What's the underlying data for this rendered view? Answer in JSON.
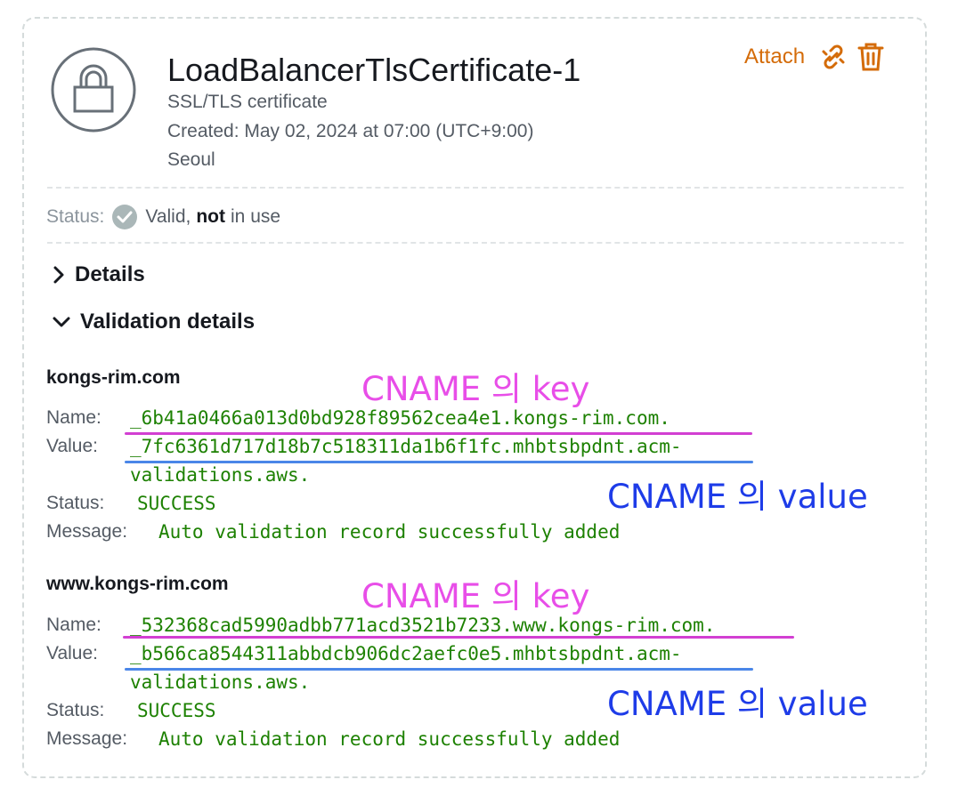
{
  "certificate": {
    "name": "LoadBalancerTlsCertificate-1",
    "type": "SSL/TLS certificate",
    "created": "Created: May 02, 2024 at 07:00 (UTC+9:00)",
    "region": "Seoul"
  },
  "actions": {
    "attach_label": "Attach",
    "attach_icon": "link-icon",
    "delete_icon": "trash-icon"
  },
  "status": {
    "label": "Status:",
    "valid": "Valid,",
    "not": "not",
    "in_use": "in use"
  },
  "sections": {
    "details": "Details",
    "validation": "Validation details"
  },
  "labels": {
    "name": "Name:",
    "value": "Value:",
    "status": "Status:",
    "message": "Message:"
  },
  "validations": [
    {
      "domain": "kongs-rim.com",
      "name": "_6b41a0466a013d0bd928f89562cea4e1.kongs-rim.com.",
      "value_line1": "_7fc6361d717d18b7c518311da1b6f1fc.mhbtsbpdnt.acm-",
      "value_line2": "validations.aws.",
      "status": "SUCCESS",
      "message": "Auto validation record successfully added",
      "annotation_key": "CNAME 의 key",
      "annotation_value": "CNAME 의 value"
    },
    {
      "domain": "www.kongs-rim.com",
      "name": "_532368cad5990adbb771acd3521b7233.www.kongs-rim.com.",
      "value_line1": "_b566ca8544311abbdcb906dc2aefc0e5.mhbtsbpdnt.acm-",
      "value_line2": "validations.aws.",
      "status": "SUCCESS",
      "message": "Auto validation record successfully added",
      "annotation_key": "CNAME 의 key",
      "annotation_value": "CNAME 의 value"
    }
  ],
  "colors": {
    "accent": "#d46b08",
    "success_text": "#1d8102",
    "annotation_key": "#e84ee8",
    "annotation_value": "#1e3ce8",
    "key_underline": "#d23fd2",
    "value_underline": "#4a86e8"
  }
}
